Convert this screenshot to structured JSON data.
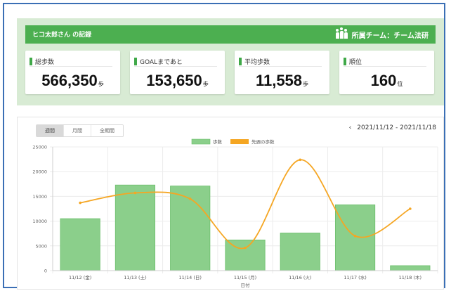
{
  "header": {
    "title": "ヒコ太郎さん の記録",
    "team": "所属チーム：チーム法研"
  },
  "stats": [
    {
      "label": "総歩数",
      "value": "566,350",
      "unit": "歩"
    },
    {
      "label": "GOALまであと",
      "value": "153,650",
      "unit": "歩"
    },
    {
      "label": "平均歩数",
      "value": "11,558",
      "unit": "歩"
    },
    {
      "label": "順位",
      "value": "160",
      "unit": "位"
    }
  ],
  "tabs": [
    {
      "label": "週間",
      "active": true
    },
    {
      "label": "月間",
      "active": false
    },
    {
      "label": "全期間",
      "active": false
    }
  ],
  "date_range": {
    "prev_icon": "chevron-left-icon",
    "text": "2021/11/12 - 2021/11/18"
  },
  "colors": {
    "bar": "#8bcf8b",
    "line": "#f5a623",
    "accent": "#4caf50"
  },
  "chart_data": {
    "type": "bar",
    "categories": [
      "11/12 (金)",
      "11/13 (土)",
      "11/14 (日)",
      "11/15 (月)",
      "11/16 (火)",
      "11/17 (水)",
      "11/18 (木)"
    ],
    "series": [
      {
        "name": "歩数",
        "type": "bar",
        "values": [
          10500,
          17300,
          17100,
          6200,
          7600,
          13300,
          1000
        ]
      },
      {
        "name": "先週の歩数",
        "type": "line",
        "values": [
          13700,
          15700,
          14500,
          4600,
          22400,
          7000,
          12500
        ]
      }
    ],
    "xlabel": "日付",
    "ylabel": "",
    "ylim": [
      0,
      25000
    ],
    "yticks": [
      0,
      5000,
      10000,
      15000,
      20000,
      25000
    ],
    "grid": true,
    "legend": "top-center"
  }
}
